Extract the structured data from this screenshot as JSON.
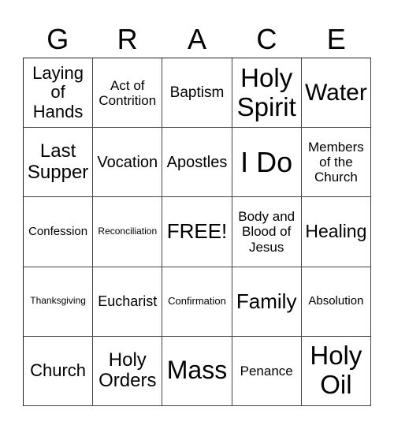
{
  "header": {
    "letters": [
      "G",
      "R",
      "A",
      "C",
      "E"
    ]
  },
  "grid": {
    "rows": [
      [
        {
          "text": "Laying of Hands",
          "lines": [
            "Laying",
            "of",
            "Hands"
          ]
        },
        {
          "text": "Act of Contrition",
          "lines": [
            "Act of",
            "Contrition"
          ]
        },
        {
          "text": "Baptism",
          "lines": [
            "Baptism"
          ]
        },
        {
          "text": "Holy Spirit",
          "lines": [
            "Holy",
            "Spirit"
          ]
        },
        {
          "text": "Water",
          "lines": [
            "Water"
          ]
        }
      ],
      [
        {
          "text": "Last Supper",
          "lines": [
            "Last",
            "Supper"
          ]
        },
        {
          "text": "Vocation",
          "lines": [
            "Vocation"
          ]
        },
        {
          "text": "Apostles",
          "lines": [
            "Apostles"
          ]
        },
        {
          "text": "I Do",
          "lines": [
            "I Do"
          ]
        },
        {
          "text": "Members of the Church",
          "lines": [
            "Members",
            "of the",
            "Church"
          ]
        }
      ],
      [
        {
          "text": "Confession",
          "lines": [
            "Confession"
          ]
        },
        {
          "text": "Reconciliation",
          "lines": [
            "Reconciliation"
          ]
        },
        {
          "text": "FREE!",
          "lines": [
            "FREE!"
          ]
        },
        {
          "text": "Body and Blood of Jesus",
          "lines": [
            "Body and",
            "Blood of",
            "Jesus"
          ]
        },
        {
          "text": "Healing",
          "lines": [
            "Healing"
          ]
        }
      ],
      [
        {
          "text": "Thanksgiving",
          "lines": [
            "Thanksgiving"
          ]
        },
        {
          "text": "Eucharist",
          "lines": [
            "Eucharist"
          ]
        },
        {
          "text": "Confirmation",
          "lines": [
            "Confirmation"
          ]
        },
        {
          "text": "Family",
          "lines": [
            "Family"
          ]
        },
        {
          "text": "Absolution",
          "lines": [
            "Absolution"
          ]
        }
      ],
      [
        {
          "text": "Church",
          "lines": [
            "Church"
          ]
        },
        {
          "text": "Holy Orders",
          "lines": [
            "Holy",
            "Orders"
          ]
        },
        {
          "text": "Mass",
          "lines": [
            "Mass"
          ]
        },
        {
          "text": "Penance",
          "lines": [
            "Penance"
          ]
        },
        {
          "text": "Holy Oil",
          "lines": [
            "Holy",
            "Oil"
          ]
        }
      ]
    ]
  }
}
